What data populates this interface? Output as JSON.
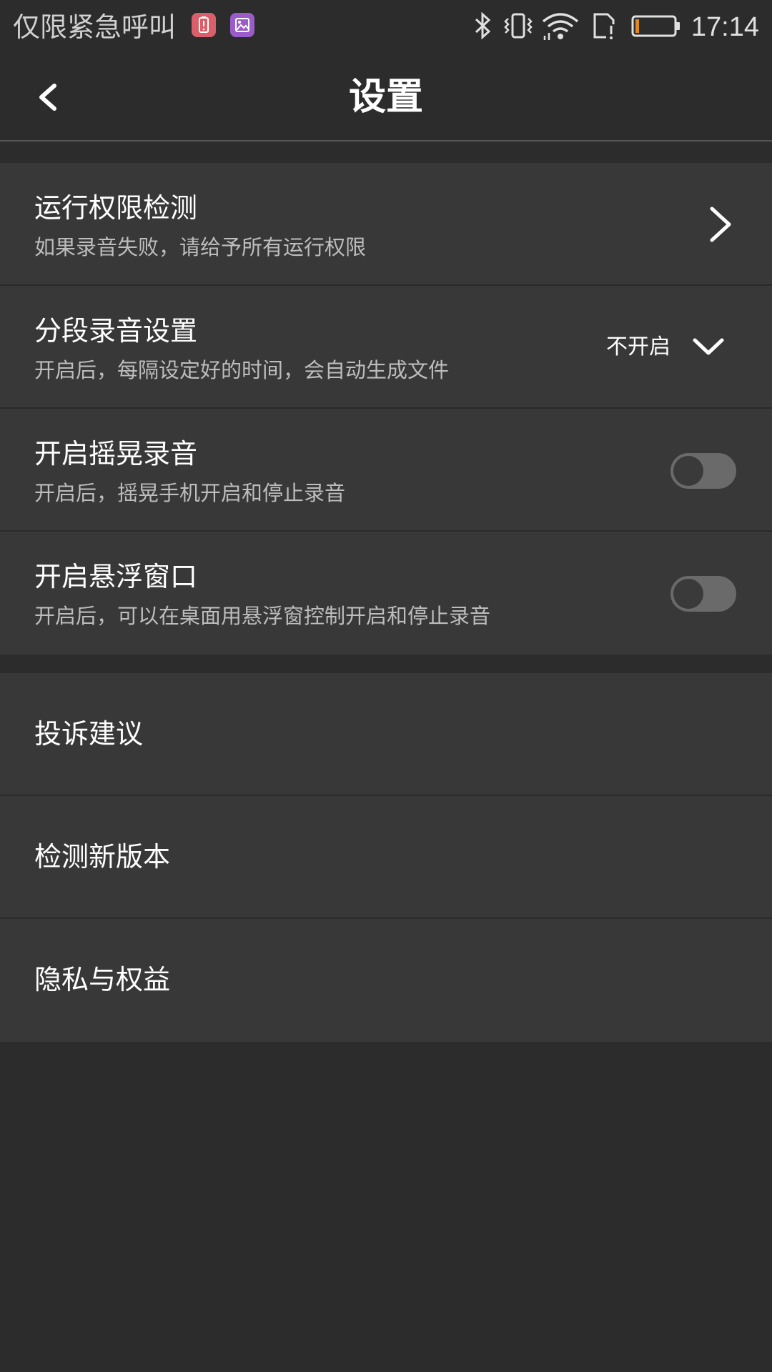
{
  "status_bar": {
    "carrier": "仅限紧急呼叫",
    "time": "17:14",
    "icons": [
      "battery-alert-icon",
      "gallery-icon",
      "bluetooth-icon",
      "vibrate-icon",
      "wifi-icon",
      "sim-alert-icon",
      "battery-icon"
    ],
    "battery_level": 0.1,
    "battery_color": "#e08a1e"
  },
  "header": {
    "title": "设置",
    "back_icon": "back-arrow-icon"
  },
  "settings": {
    "items": [
      {
        "title": "运行权限检测",
        "subtitle": "如果录音失败，请给予所有运行权限",
        "control": "chevron-right-icon"
      },
      {
        "title": "分段录音设置",
        "subtitle": "开启后，每隔设定好的时间，会自动生成文件",
        "control": "dropdown",
        "value": "不开启"
      },
      {
        "title": "开启摇晃录音",
        "subtitle": "开启后，摇晃手机开启和停止录音",
        "control": "toggle",
        "checked": false
      },
      {
        "title": "开启悬浮窗口",
        "subtitle": "开启后，可以在桌面用悬浮窗控制开启和停止录音",
        "control": "toggle",
        "checked": false
      }
    ]
  },
  "more": {
    "items": [
      {
        "title": "投诉建议"
      },
      {
        "title": "检测新版本"
      },
      {
        "title": "隐私与权益"
      }
    ]
  },
  "colors": {
    "background": "#2c2c2c",
    "row_background": "#383838",
    "subtitle_text": "#bdbdbd",
    "toggle_track": "#6a6a6a"
  }
}
